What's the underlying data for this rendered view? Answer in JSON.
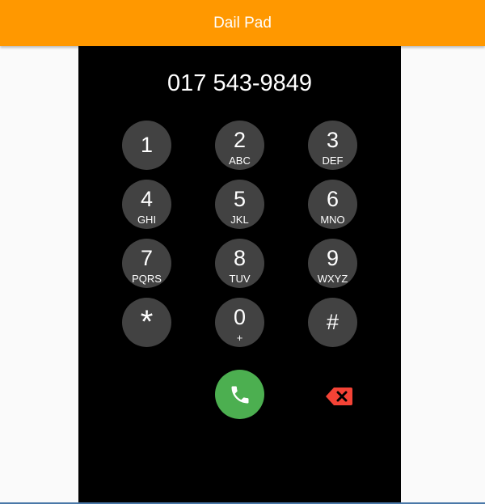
{
  "appbar": {
    "title": "Dail Pad",
    "color": "#ff9800"
  },
  "display": {
    "number": "017 543-9849"
  },
  "keypad": {
    "keys": [
      {
        "digit": "1",
        "letters": ""
      },
      {
        "digit": "2",
        "letters": "ABC"
      },
      {
        "digit": "3",
        "letters": "DEF"
      },
      {
        "digit": "4",
        "letters": "GHI"
      },
      {
        "digit": "5",
        "letters": "JKL"
      },
      {
        "digit": "6",
        "letters": "MNO"
      },
      {
        "digit": "7",
        "letters": "PQRS"
      },
      {
        "digit": "8",
        "letters": "TUV"
      },
      {
        "digit": "9",
        "letters": "WXYZ"
      },
      {
        "digit": "*",
        "letters": ""
      },
      {
        "digit": "0",
        "letters": "+"
      },
      {
        "digit": "#",
        "letters": ""
      }
    ],
    "key_color": "#424242"
  },
  "actions": {
    "call_icon": "phone-icon",
    "call_color": "#4caf50",
    "backspace_icon": "backspace-icon",
    "backspace_color": "#f44336"
  }
}
